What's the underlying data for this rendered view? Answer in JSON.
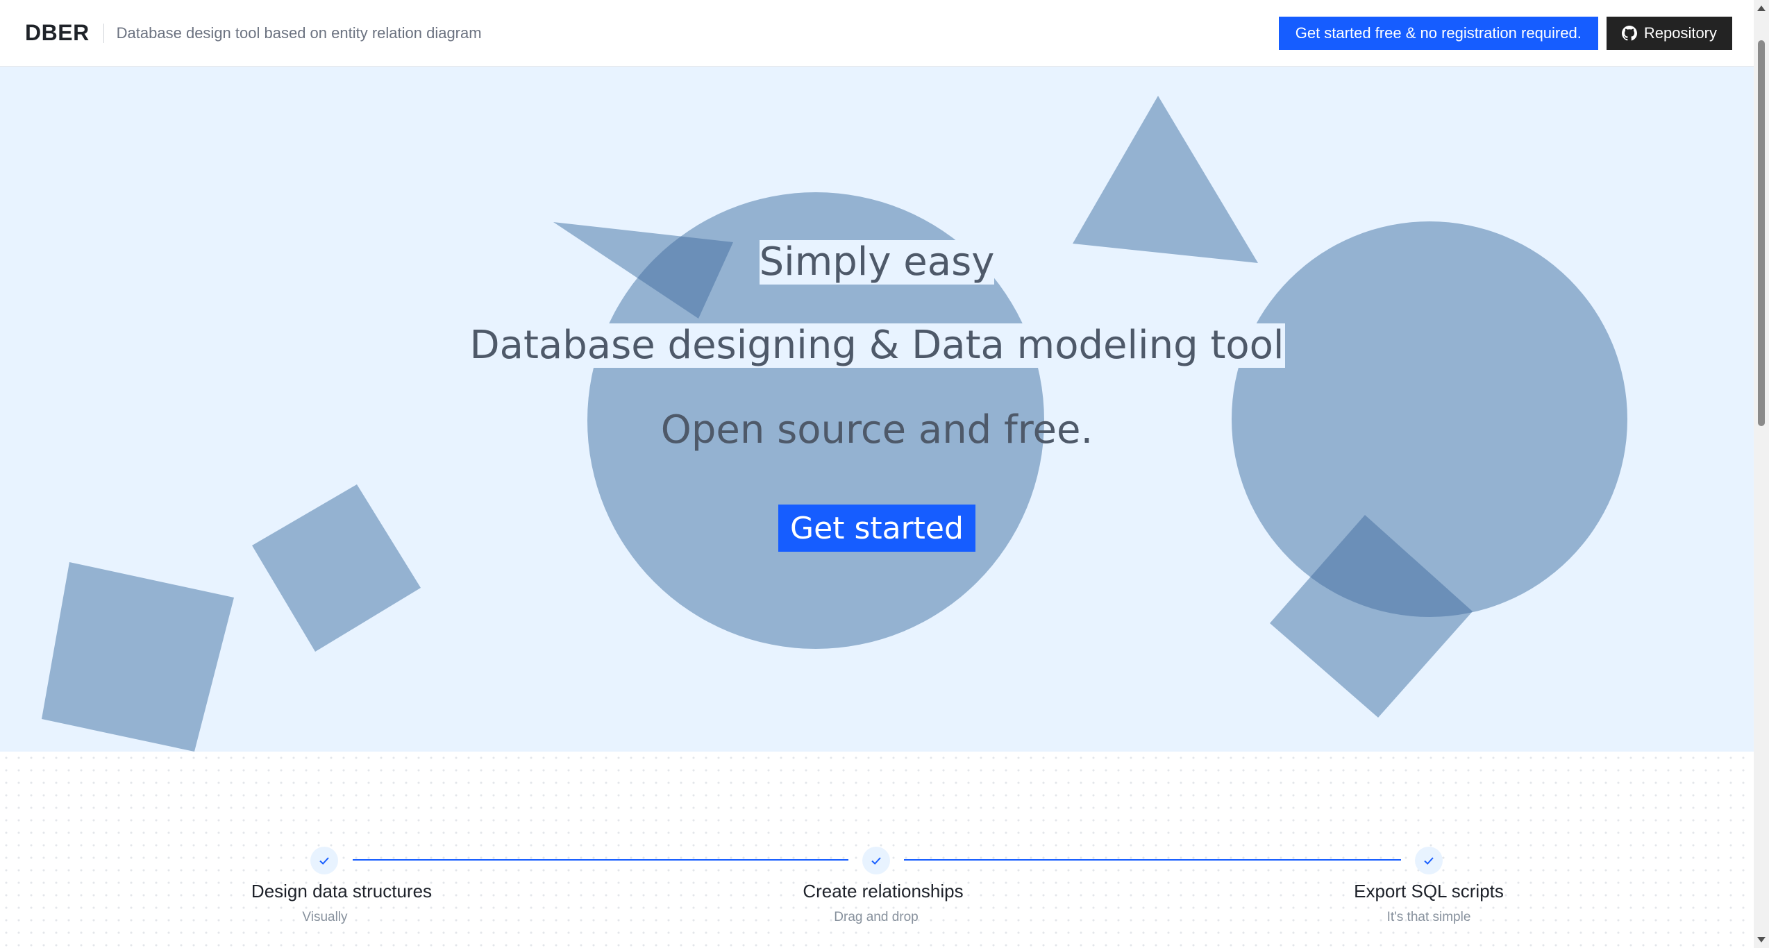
{
  "header": {
    "brand": "DBER",
    "tagline": "Database design tool based on entity relation diagram",
    "get_started_label": "Get started free & no registration required.",
    "repository_label": "Repository"
  },
  "hero": {
    "line1": "Simply easy",
    "line2": "Database designing & Data modeling tool",
    "line3": "Open source and free.",
    "cta_label": "Get started"
  },
  "features": {
    "steps": [
      {
        "title": "Design data structures",
        "subtitle": "Visually"
      },
      {
        "title": "Create relationships",
        "subtitle": "Drag and drop"
      },
      {
        "title": "Export SQL scripts",
        "subtitle": "It's that simple"
      }
    ]
  },
  "colors": {
    "accent": "#165dff",
    "hero_background": "#e8f3ff",
    "shape_fill": "#94b2d1",
    "shape_overlap": "#6b8fb8",
    "dark_button": "#232323"
  },
  "icons": {
    "repository": "github-icon",
    "step": "check-icon"
  }
}
